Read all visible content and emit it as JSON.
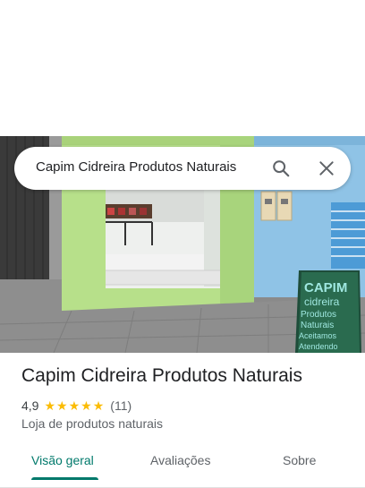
{
  "search": {
    "query": "Capim Cidreira Produtos Naturais",
    "search_icon": "search-icon",
    "close_icon": "close-icon"
  },
  "place": {
    "name": "Capim Cidreira Produtos Naturais",
    "rating": "4,9",
    "stars": 5,
    "review_count": "(11)",
    "category": "Loja de produtos naturais",
    "sign_text": [
      "CAPIM",
      "cidreira",
      "Produtos",
      "Naturais",
      "Aceitamos",
      "Atendendo"
    ]
  },
  "tabs": [
    {
      "label": "Visão geral",
      "active": true
    },
    {
      "label": "Avaliações",
      "active": false
    },
    {
      "label": "Sobre",
      "active": false
    }
  ],
  "colors": {
    "accent": "#00796b",
    "star": "#fbbc04",
    "wall_green": "#b7e08a",
    "wall_blue": "#8fc3e6"
  }
}
